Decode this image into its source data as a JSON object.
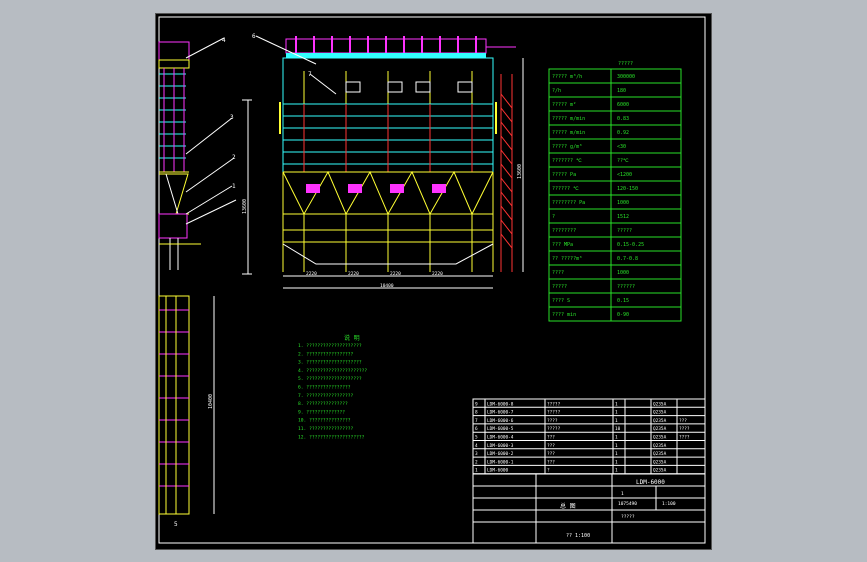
{
  "viewer": {
    "background": "#b7bcc2",
    "sheet_background": "#000000"
  },
  "colors": {
    "frame": "#ffffff",
    "dim": "#ffffff",
    "table_line": "#29e129",
    "notes": "#29e129",
    "structure_yellow": "#ffff33",
    "structure_magenta": "#ff33ff",
    "structure_cyan": "#33ffff",
    "structure_red": "#ff3333"
  },
  "drawing": {
    "side_view": {
      "callouts": [
        "1",
        "2",
        "3",
        "4"
      ],
      "height_dim": "13600"
    },
    "front_view": {
      "callouts": [
        "6",
        "7"
      ],
      "height_dim": "13600",
      "bay_dims": [
        "2220",
        "2220",
        "2220",
        "2220"
      ],
      "total_dim": "10400"
    },
    "plan_view": {
      "height_dim": "10400",
      "callout": "5"
    },
    "param_table": {
      "title": "?????",
      "rows": [
        {
          "label": "?????  m³/h",
          "value": "300000"
        },
        {
          "label": "?/h",
          "value": "180"
        },
        {
          "label": "?????  m²",
          "value": "6000"
        },
        {
          "label": "?????  m/min",
          "value": "0.83"
        },
        {
          "label": "?????  m/min",
          "value": "0.92"
        },
        {
          "label": "?????  g/m³",
          "value": "<30"
        },
        {
          "label": "???????  ℃",
          "value": "??℃"
        },
        {
          "label": "?????  Pa",
          "value": "<1200"
        },
        {
          "label": "??????  ℃",
          "value": "120-150"
        },
        {
          "label": "????????  Pa",
          "value": "1000"
        },
        {
          "label": "?",
          "value": "1512"
        },
        {
          "label": "????????",
          "value": "?????"
        },
        {
          "label": "???  MPa",
          "value": "0.15-0.25"
        },
        {
          "label": "??  ?????m³",
          "value": "0.7-0.8"
        },
        {
          "label": "????",
          "value": "1000"
        },
        {
          "label": "?????",
          "value": "??????"
        },
        {
          "label": "????  S",
          "value": "0.15"
        },
        {
          "label": "????  min",
          "value": "0-90"
        }
      ]
    },
    "notes": {
      "title": "说  明",
      "lines": [
        "1. ????????????????????",
        "2. ?????????????????",
        "3. ????????????????????",
        "4. ??????????????????????",
        "5. ????????????????????",
        "6. ????????????????",
        "7. ?????????????????",
        "8. ???????????????",
        "9. ??????????????",
        "10. ???????????????",
        "11. ????????????????",
        "12. ????????????????????"
      ]
    },
    "bom": {
      "rows": [
        {
          "no": "9",
          "code": "LDM-6000-8",
          "name": "?????",
          "qty": "1",
          "mat": "Q235A"
        },
        {
          "no": "8",
          "code": "LDM-6000-7",
          "name": "?????",
          "qty": "1",
          "mat": "Q235A"
        },
        {
          "no": "7",
          "code": "LDM-6000-6",
          "name": "????",
          "qty": "1",
          "mat": "Q235A",
          "note": "???"
        },
        {
          "no": "6",
          "code": "LDM-6000-5",
          "name": "?????",
          "qty": "10",
          "mat": "Q235A",
          "note": "????"
        },
        {
          "no": "5",
          "code": "LDM-6000-4",
          "name": "???",
          "qty": "1",
          "mat": "Q235A",
          "note": "????"
        },
        {
          "no": "4",
          "code": "LDM-6000-3",
          "name": "???",
          "qty": "1",
          "mat": "Q235A"
        },
        {
          "no": "3",
          "code": "LDM-6000-2",
          "name": "???",
          "qty": "1",
          "mat": "Q235A"
        },
        {
          "no": "2",
          "code": "LDM-6000-1",
          "name": "???",
          "qty": "1",
          "mat": "Q235A"
        },
        {
          "no": "1",
          "code": "LDM-6000",
          "name": "?",
          "qty": "1",
          "mat": "Q235A"
        }
      ]
    },
    "title_block": {
      "drawing_no": "LDM-6000",
      "name": "总 图",
      "scale": "1:100",
      "weight": "1075490",
      "sheet": "1",
      "company": "?????",
      "footer": "?? 1:100"
    }
  }
}
